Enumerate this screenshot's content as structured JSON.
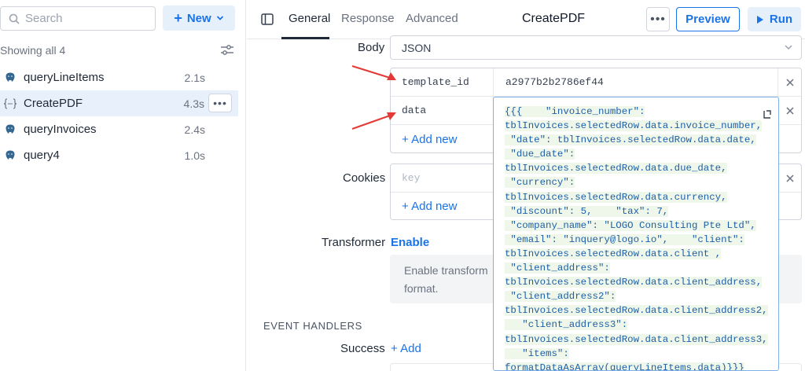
{
  "sidebar": {
    "search_placeholder": "Search",
    "new_label": "New",
    "showing_text": "Showing all 4",
    "queries": [
      {
        "name": "queryLineItems",
        "time": "2.1s",
        "icon": "postgres-icon"
      },
      {
        "name": "CreatePDF",
        "time": "4.3s",
        "icon": "js-code-icon",
        "selected": true
      },
      {
        "name": "queryInvoices",
        "time": "2.4s",
        "icon": "postgres-icon"
      },
      {
        "name": "query4",
        "time": "1.0s",
        "icon": "postgres-icon"
      }
    ],
    "more_label": "•••"
  },
  "topbar": {
    "tabs": [
      "General",
      "Response",
      "Advanced"
    ],
    "active_tab": "General",
    "title": "CreatePDF",
    "more_label": "•••",
    "preview_label": "Preview",
    "run_label": "Run"
  },
  "form": {
    "body_label": "Body",
    "body_value": "JSON",
    "params": [
      {
        "key": "template_id",
        "value": "a2977b2b2786ef44"
      },
      {
        "key": "data",
        "value": ""
      }
    ],
    "add_new_label": "+ Add new",
    "cookies_label": "Cookies",
    "cookies_key_placeholder": "key",
    "transformer_label": "Transformer",
    "transformer_enable": "Enable",
    "transformer_hint_line1": "Enable transform",
    "transformer_hint_line2": "format.",
    "event_handlers_header": "EVENT HANDLERS",
    "success_label": "Success",
    "success_add": "+ Add"
  },
  "code": {
    "lines": [
      "{{{    \"invoice_number\":",
      "tblInvoices.selectedRow.data.invoice_number,",
      " \"date\": tblInvoices.selectedRow.data.date,",
      " \"due_date\":",
      "tblInvoices.selectedRow.data.due_date,",
      " \"currency\":",
      "tblInvoices.selectedRow.data.currency,",
      " \"discount\": 5,    \"tax\": 7,",
      " \"company_name\": \"LOGO Consulting Pte Ltd\",",
      " \"email\": \"inquery@logo.io\",    \"client\":",
      "tblInvoices.selectedRow.data.client ,",
      " \"client_address\":",
      "tblInvoices.selectedRow.data.client_address,",
      " \"client_address2\":",
      "tblInvoices.selectedRow.data.client_address2,",
      "   \"client_address3\":",
      "tblInvoices.selectedRow.data.client_address3,",
      "   \"items\":",
      "formatDataAsArray(queryLineItems.data)}}}"
    ]
  },
  "colors": {
    "accent": "#1a73e8",
    "annotation_arrow": "#e53935",
    "selected_row": "#e8f1fb",
    "code_highlight": "#eef7e9"
  }
}
